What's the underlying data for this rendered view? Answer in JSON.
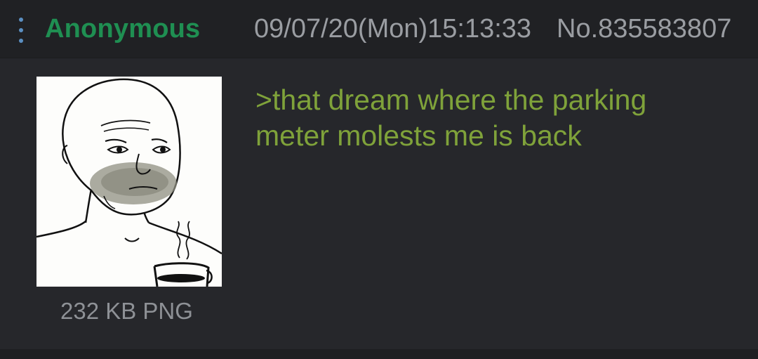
{
  "post": {
    "name": "Anonymous",
    "datetime": "09/07/20(Mon)15:13:33",
    "post_number": "No.835583807",
    "file_info": "232 KB PNG",
    "comment_lines": [
      ">that dream where the parking",
      "meter molests me is back"
    ]
  },
  "colors": {
    "name": "#1f8f52",
    "greentext": "#7fa23a",
    "meta": "#9a9da2",
    "background": "#26272b",
    "header_background": "#202124"
  },
  "icons": {
    "menu": "vertical-ellipsis-icon"
  }
}
